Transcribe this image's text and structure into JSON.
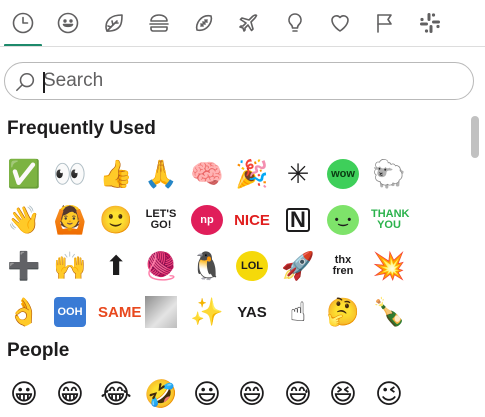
{
  "tabs": [
    {
      "name": "tab-recent",
      "icon": "clock-icon"
    },
    {
      "name": "tab-people",
      "icon": "smiley-icon"
    },
    {
      "name": "tab-nature",
      "icon": "leaf-icon"
    },
    {
      "name": "tab-food",
      "icon": "burger-icon"
    },
    {
      "name": "tab-activity",
      "icon": "football-icon"
    },
    {
      "name": "tab-travel",
      "icon": "airplane-icon"
    },
    {
      "name": "tab-objects",
      "icon": "lightbulb-icon"
    },
    {
      "name": "tab-symbols",
      "icon": "heart-icon"
    },
    {
      "name": "tab-flags",
      "icon": "flag-icon"
    },
    {
      "name": "tab-custom",
      "icon": "slack-logo-icon"
    }
  ],
  "search": {
    "placeholder": "Search"
  },
  "sections": {
    "frequent": {
      "title": "Frequently Used"
    },
    "people": {
      "title": "People"
    }
  },
  "frequent_rows": [
    [
      {
        "kind": "emoji",
        "char": "✅",
        "name": "white-check-mark-emoji"
      },
      {
        "kind": "emoji",
        "char": "👀",
        "name": "eyes-emoji"
      },
      {
        "kind": "emoji",
        "char": "👍",
        "name": "thumbsup-emoji"
      },
      {
        "kind": "emoji",
        "char": "🙏",
        "name": "pray-emoji"
      },
      {
        "kind": "emoji",
        "char": "🧠",
        "name": "brain-emoji"
      },
      {
        "kind": "emoji",
        "char": "🎉",
        "name": "tada-emoji"
      },
      {
        "kind": "emoji",
        "char": "✳",
        "name": "pixel-sparkle-emoji"
      },
      {
        "kind": "badge",
        "text": "wow",
        "bg": "#3ecf5a",
        "fg": "#0a3b12",
        "name": "wow-emoji"
      },
      {
        "kind": "emoji",
        "char": "🐑",
        "name": "llama-emoji"
      }
    ],
    [
      {
        "kind": "emoji",
        "char": "👋",
        "name": "wave-emoji"
      },
      {
        "kind": "emoji",
        "char": "🙆",
        "name": "woman-gesturing-emoji"
      },
      {
        "kind": "emoji",
        "char": "🙂",
        "name": "slightly-smiling-emoji"
      },
      {
        "kind": "text",
        "text": "LET'S GO!",
        "fg": "#1d1c1d",
        "name": "lets-go-emoji"
      },
      {
        "kind": "badge",
        "text": "np",
        "bg": "#e01e5a",
        "fg": "#ffffff",
        "name": "np-emoji"
      },
      {
        "kind": "text",
        "text": "NICE",
        "fg": "#e01e1e",
        "name": "nice-emoji"
      },
      {
        "kind": "text",
        "text": "N",
        "fg": "#1d1c1d",
        "name": "notion-emoji"
      },
      {
        "kind": "badge",
        "text": "•‿•",
        "bg": "#7ee36a",
        "fg": "#1d1c1d",
        "name": "blob-emoji"
      },
      {
        "kind": "text",
        "text": "THANK YOU",
        "fg": "#2bb24c",
        "name": "thank-you-emoji"
      }
    ],
    [
      {
        "kind": "emoji",
        "char": "➕",
        "name": "heavy-plus-emoji"
      },
      {
        "kind": "emoji",
        "char": "🙌",
        "name": "raised-hands-emoji"
      },
      {
        "kind": "emoji",
        "char": "⬆",
        "name": "arrow-up-emoji"
      },
      {
        "kind": "emoji",
        "char": "🧶",
        "name": "yarn-emoji"
      },
      {
        "kind": "emoji",
        "char": "🐧",
        "name": "penguin-emoji"
      },
      {
        "kind": "badge",
        "text": "LOL",
        "bg": "#f5d90a",
        "fg": "#1d1c1d",
        "name": "lol-emoji"
      },
      {
        "kind": "emoji",
        "char": "🚀",
        "name": "rocket-emoji"
      },
      {
        "kind": "text",
        "text": "thx fren",
        "fg": "#1d1c1d",
        "name": "thx-fren-emoji"
      },
      {
        "kind": "emoji",
        "char": "💥",
        "name": "boom-emoji"
      }
    ],
    [
      {
        "kind": "emoji",
        "char": "👌",
        "name": "ok-hand-emoji"
      },
      {
        "kind": "badge",
        "text": "OOH",
        "bg": "#3a7bd5",
        "fg": "#ffffff",
        "name": "ooh-emoji"
      },
      {
        "kind": "text",
        "text": "SAME",
        "fg": "#e8481e",
        "name": "same-emoji"
      },
      {
        "kind": "photo",
        "name": "photo-emoji"
      },
      {
        "kind": "emoji",
        "char": "✨",
        "name": "sparkles-emoji"
      },
      {
        "kind": "text",
        "text": "YAS",
        "fg": "#1d1c1d",
        "name": "yas-emoji"
      },
      {
        "kind": "emoji",
        "char": "☝",
        "name": "point-up-emoji"
      },
      {
        "kind": "emoji",
        "char": "🤔",
        "name": "thinking-emoji"
      },
      {
        "kind": "emoji",
        "char": "🍾",
        "name": "bottle-emoji"
      }
    ]
  ],
  "people_row": [
    {
      "kind": "emoji",
      "char": "😀",
      "name": "grinning-emoji"
    },
    {
      "kind": "emoji",
      "char": "😁",
      "name": "grin-emoji"
    },
    {
      "kind": "emoji",
      "char": "😂",
      "name": "joy-emoji"
    },
    {
      "kind": "emoji",
      "char": "🤣",
      "name": "rofl-emoji"
    },
    {
      "kind": "emoji",
      "char": "😃",
      "name": "smiley-emoji"
    },
    {
      "kind": "emoji",
      "char": "😄",
      "name": "smile-emoji"
    },
    {
      "kind": "emoji",
      "char": "😅",
      "name": "sweat-smile-emoji"
    },
    {
      "kind": "emoji",
      "char": "😆",
      "name": "laughing-emoji"
    },
    {
      "kind": "emoji",
      "char": "😉",
      "name": "wink-emoji"
    }
  ]
}
